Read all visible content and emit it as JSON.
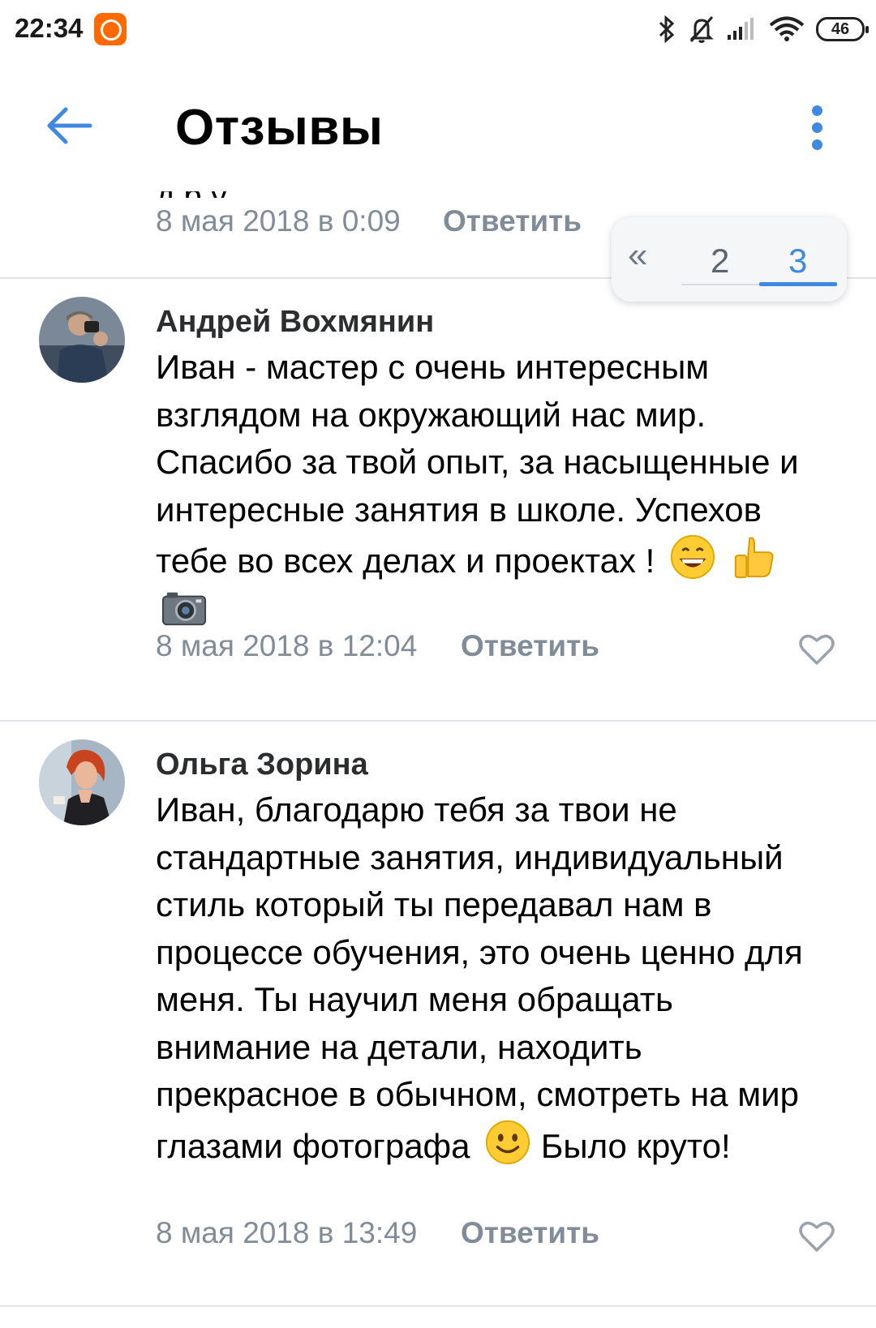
{
  "status_bar": {
    "time": "22:34",
    "battery": "46"
  },
  "header": {
    "title": "Отзывы"
  },
  "prev_comment": {
    "clipped_text": "д р у",
    "date": "8 мая 2018 в 0:09",
    "reply": "Ответить"
  },
  "pagination": {
    "first": "«",
    "pages": [
      "2",
      "3"
    ],
    "active": "3"
  },
  "comments": [
    {
      "author": "Андрей Вохмянин",
      "text": "Иван - мастер с очень интересным взглядом на окружающий нас мир. Спасибо за твой опыт, за насыщенные и интересные занятия в школе. Успехов тебе во всех делах и проектах !",
      "emojis": [
        "grinning-face-emoji",
        "thumbs-up-emoji",
        "camera-emoji"
      ],
      "date": "8 мая 2018 в 12:04",
      "reply": "Ответить"
    },
    {
      "author": "Ольга Зорина",
      "text": "Иван, благодарю тебя за твои не стандартные занятия, индивидуальный стиль который ты передавал нам в процессе обучения, это очень ценно для меня. Ты научил меня обращать внимание на детали, находить прекрасное в обычном, смотреть на мир глазами фотографа",
      "emoji": "slightly-smiling-face-emoji",
      "text_after_emoji": "Было круто!",
      "date": "8 мая 2018 в 13:49",
      "reply": "Ответить"
    }
  ],
  "colors": {
    "accent": "#3f8ae0",
    "meta": "#818c99",
    "divider": "#e1e3e6"
  }
}
